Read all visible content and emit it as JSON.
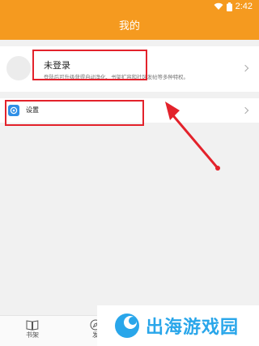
{
  "status_bar": {
    "time": "2:42"
  },
  "header": {
    "title": "我的"
  },
  "login_card": {
    "title": "未登录",
    "description": "登陆后可升级获得自动净化、书架扩容和社区发帖等多种特权。"
  },
  "settings": {
    "label": "设置"
  },
  "tabs": [
    {
      "label": "书架"
    },
    {
      "label": "发"
    }
  ],
  "watermark": {
    "text": "出海游戏园"
  },
  "colors": {
    "header_bg": "#f59a1f",
    "annotation_red": "#e3222b",
    "settings_icon_bg": "#2f8fe6",
    "watermark_blue": "#29a6ea"
  }
}
